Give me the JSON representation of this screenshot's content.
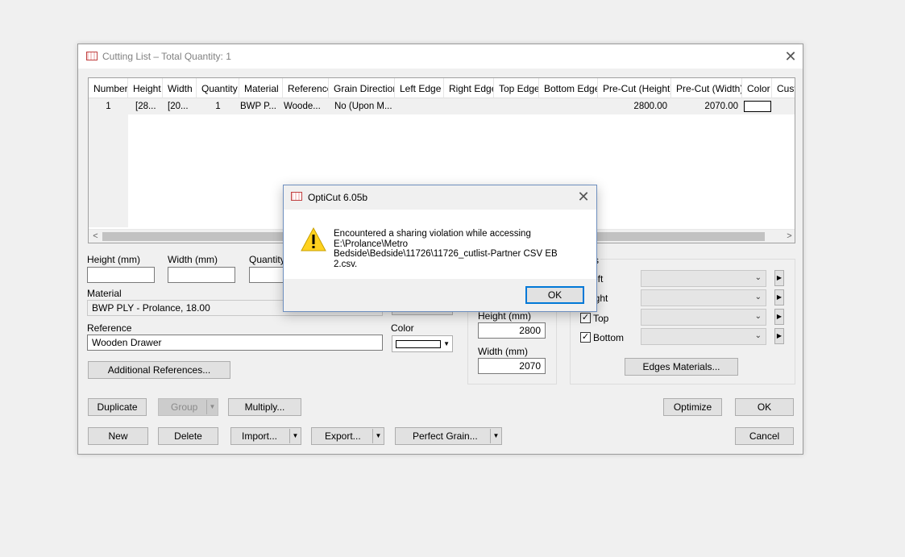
{
  "window": {
    "title": "Cutting List – Total Quantity: 1",
    "close_glyph": "✕"
  },
  "grid": {
    "columns": [
      "Number",
      "Height",
      "Width",
      "Quantity",
      "Material",
      "Reference",
      "Grain Direction",
      "Left Edge",
      "Right Edge",
      "Top Edge",
      "Bottom Edge",
      "Pre-Cut (Height)",
      "Pre-Cut (Width)",
      "Color",
      "Cust"
    ],
    "rows": [
      {
        "number": "1",
        "height": "[28...",
        "width": "[20...",
        "quantity": "1",
        "material": "BWP P...",
        "reference": "Woode...",
        "grain": "No (Upon M...",
        "left_edge": "",
        "right_edge": "",
        "top_edge": "",
        "bottom_edge": "",
        "precut_height": "2800.00",
        "precut_width": "2070.00",
        "color": "#ffffff"
      }
    ],
    "scroll_left": "<",
    "scroll_right": ">"
  },
  "form": {
    "height_label": "Height (mm)",
    "width_label": "Width (mm)",
    "quantity_label": "Quantity",
    "height_value": "",
    "width_value": "",
    "quantity_value": "",
    "material_label": "Material",
    "material_value": "BWP PLY - Prolance, 18.00",
    "reference_label": "Reference",
    "reference_value": "Wooden Drawer",
    "color_label": "Color",
    "additional_references": "Additional References...",
    "precut_height_label": "Height (mm)",
    "precut_height_value": "2800",
    "precut_width_label": "Width (mm)",
    "precut_width_value": "2070",
    "edges": {
      "group_label": "s",
      "left": "eft",
      "right": "ight",
      "top": "Top",
      "bottom": "Bottom",
      "edges_materials": "Edges Materials..."
    }
  },
  "buttons": {
    "duplicate": "Duplicate",
    "group": "Group",
    "multiply": "Multiply...",
    "optimize": "Optimize",
    "ok": "OK",
    "new": "New",
    "delete": "Delete",
    "import": "Import...",
    "export": "Export...",
    "perfect_grain": "Perfect Grain...",
    "cancel": "Cancel"
  },
  "dialog": {
    "title": "OptiCut 6.05b",
    "message_line1": "Encountered a sharing violation while accessing",
    "message_line2": "E:\\Prolance\\Metro",
    "message_line3": "Bedside\\Bedside\\11726\\11726_cutlist-Partner CSV EB 2.csv.",
    "ok": "OK",
    "close_glyph": "✕"
  },
  "glyphs": {
    "dropdown": "▼",
    "chevron": "⌄",
    "play": "▶",
    "check": "✓"
  }
}
